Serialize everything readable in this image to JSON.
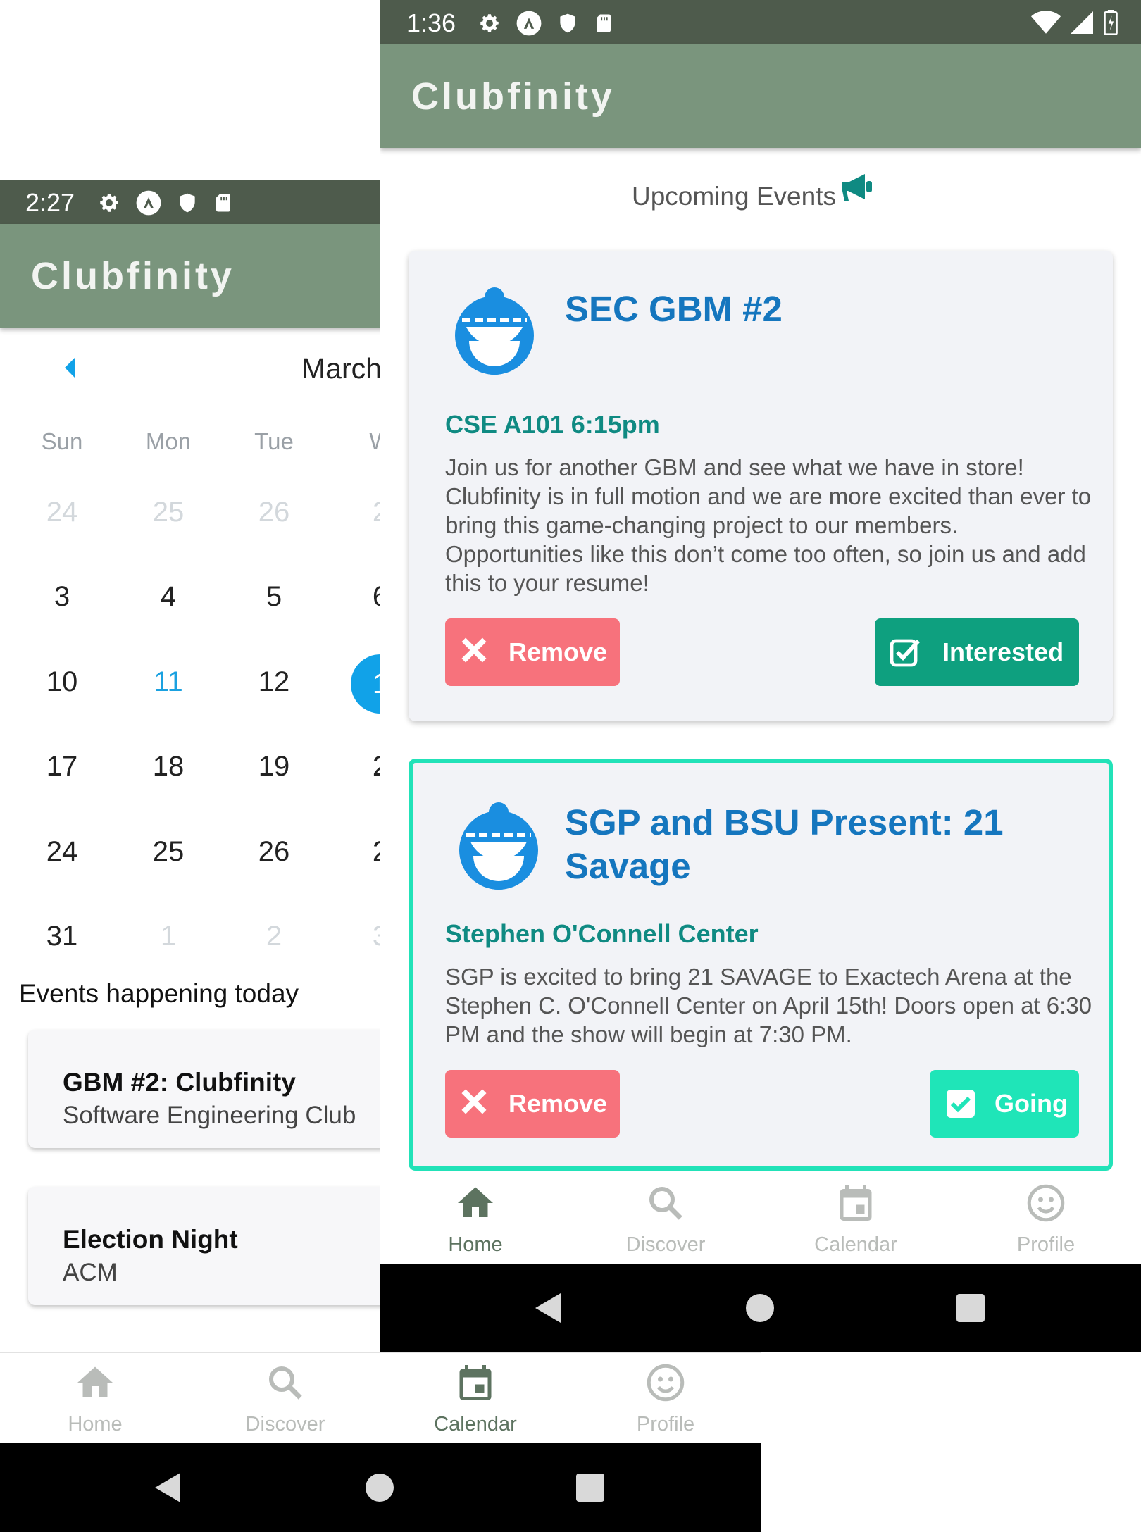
{
  "calendar_screen": {
    "status": {
      "time": "2:27"
    },
    "appbar": {
      "title": "Clubfinity"
    },
    "calendar": {
      "month": "March",
      "weekdays": [
        "Sun",
        "Mon",
        "Tue",
        "W"
      ],
      "weeks": [
        [
          "24",
          "25",
          "26",
          "2"
        ],
        [
          "3",
          "4",
          "5",
          "6"
        ],
        [
          "10",
          "11",
          "12",
          "1"
        ],
        [
          "17",
          "18",
          "19",
          "2"
        ],
        [
          "24",
          "25",
          "26",
          "2"
        ],
        [
          "31",
          "1",
          "2",
          "3"
        ]
      ]
    },
    "events_heading": "Events happening today",
    "events": [
      {
        "title": "GBM #2: Clubfinity",
        "club": "Software Engineering Club"
      },
      {
        "title": "Election Night",
        "club": "ACM"
      }
    ],
    "nav": [
      "Home",
      "Discover",
      "Calendar",
      "Profile"
    ],
    "active_tab": "Calendar"
  },
  "home_screen": {
    "status": {
      "time": "1:36"
    },
    "appbar": {
      "title": "Clubfinity"
    },
    "upcoming_title": "Upcoming Events",
    "cards": [
      {
        "title": "SEC GBM #2",
        "location": "CSE A101 6:15pm",
        "description": "Join us for another GBM and see what we have in store! Clubfinity is in full motion and we are more excited than ever to bring this game-changing project to our members. Opportunities like this don’t come too often, so join us and add this to your resume!",
        "remove_label": "Remove",
        "status_label": "Interested"
      },
      {
        "title": "SGP and BSU Present: 21 Savage",
        "location": "Stephen O'Connell Center",
        "description": "SGP is excited to bring 21 SAVAGE to Exactech Arena at the Stephen C. O'Connell Center on April 15th! Doors open at 6:30 PM and the show will begin at 7:30 PM.",
        "remove_label": "Remove",
        "status_label": "Going"
      }
    ],
    "nav": [
      "Home",
      "Discover",
      "Calendar",
      "Profile"
    ],
    "active_tab": "Home"
  },
  "colors": {
    "status_bar": "#4e5b4c",
    "app_bar": "#7a957d",
    "title_blue": "#1576be",
    "location_teal": "#0f8a82",
    "remove_red": "#f7727c",
    "interested_green": "#0ea07f",
    "going_mint": "#1fe5b8",
    "selected_day": "#11a2e8"
  }
}
